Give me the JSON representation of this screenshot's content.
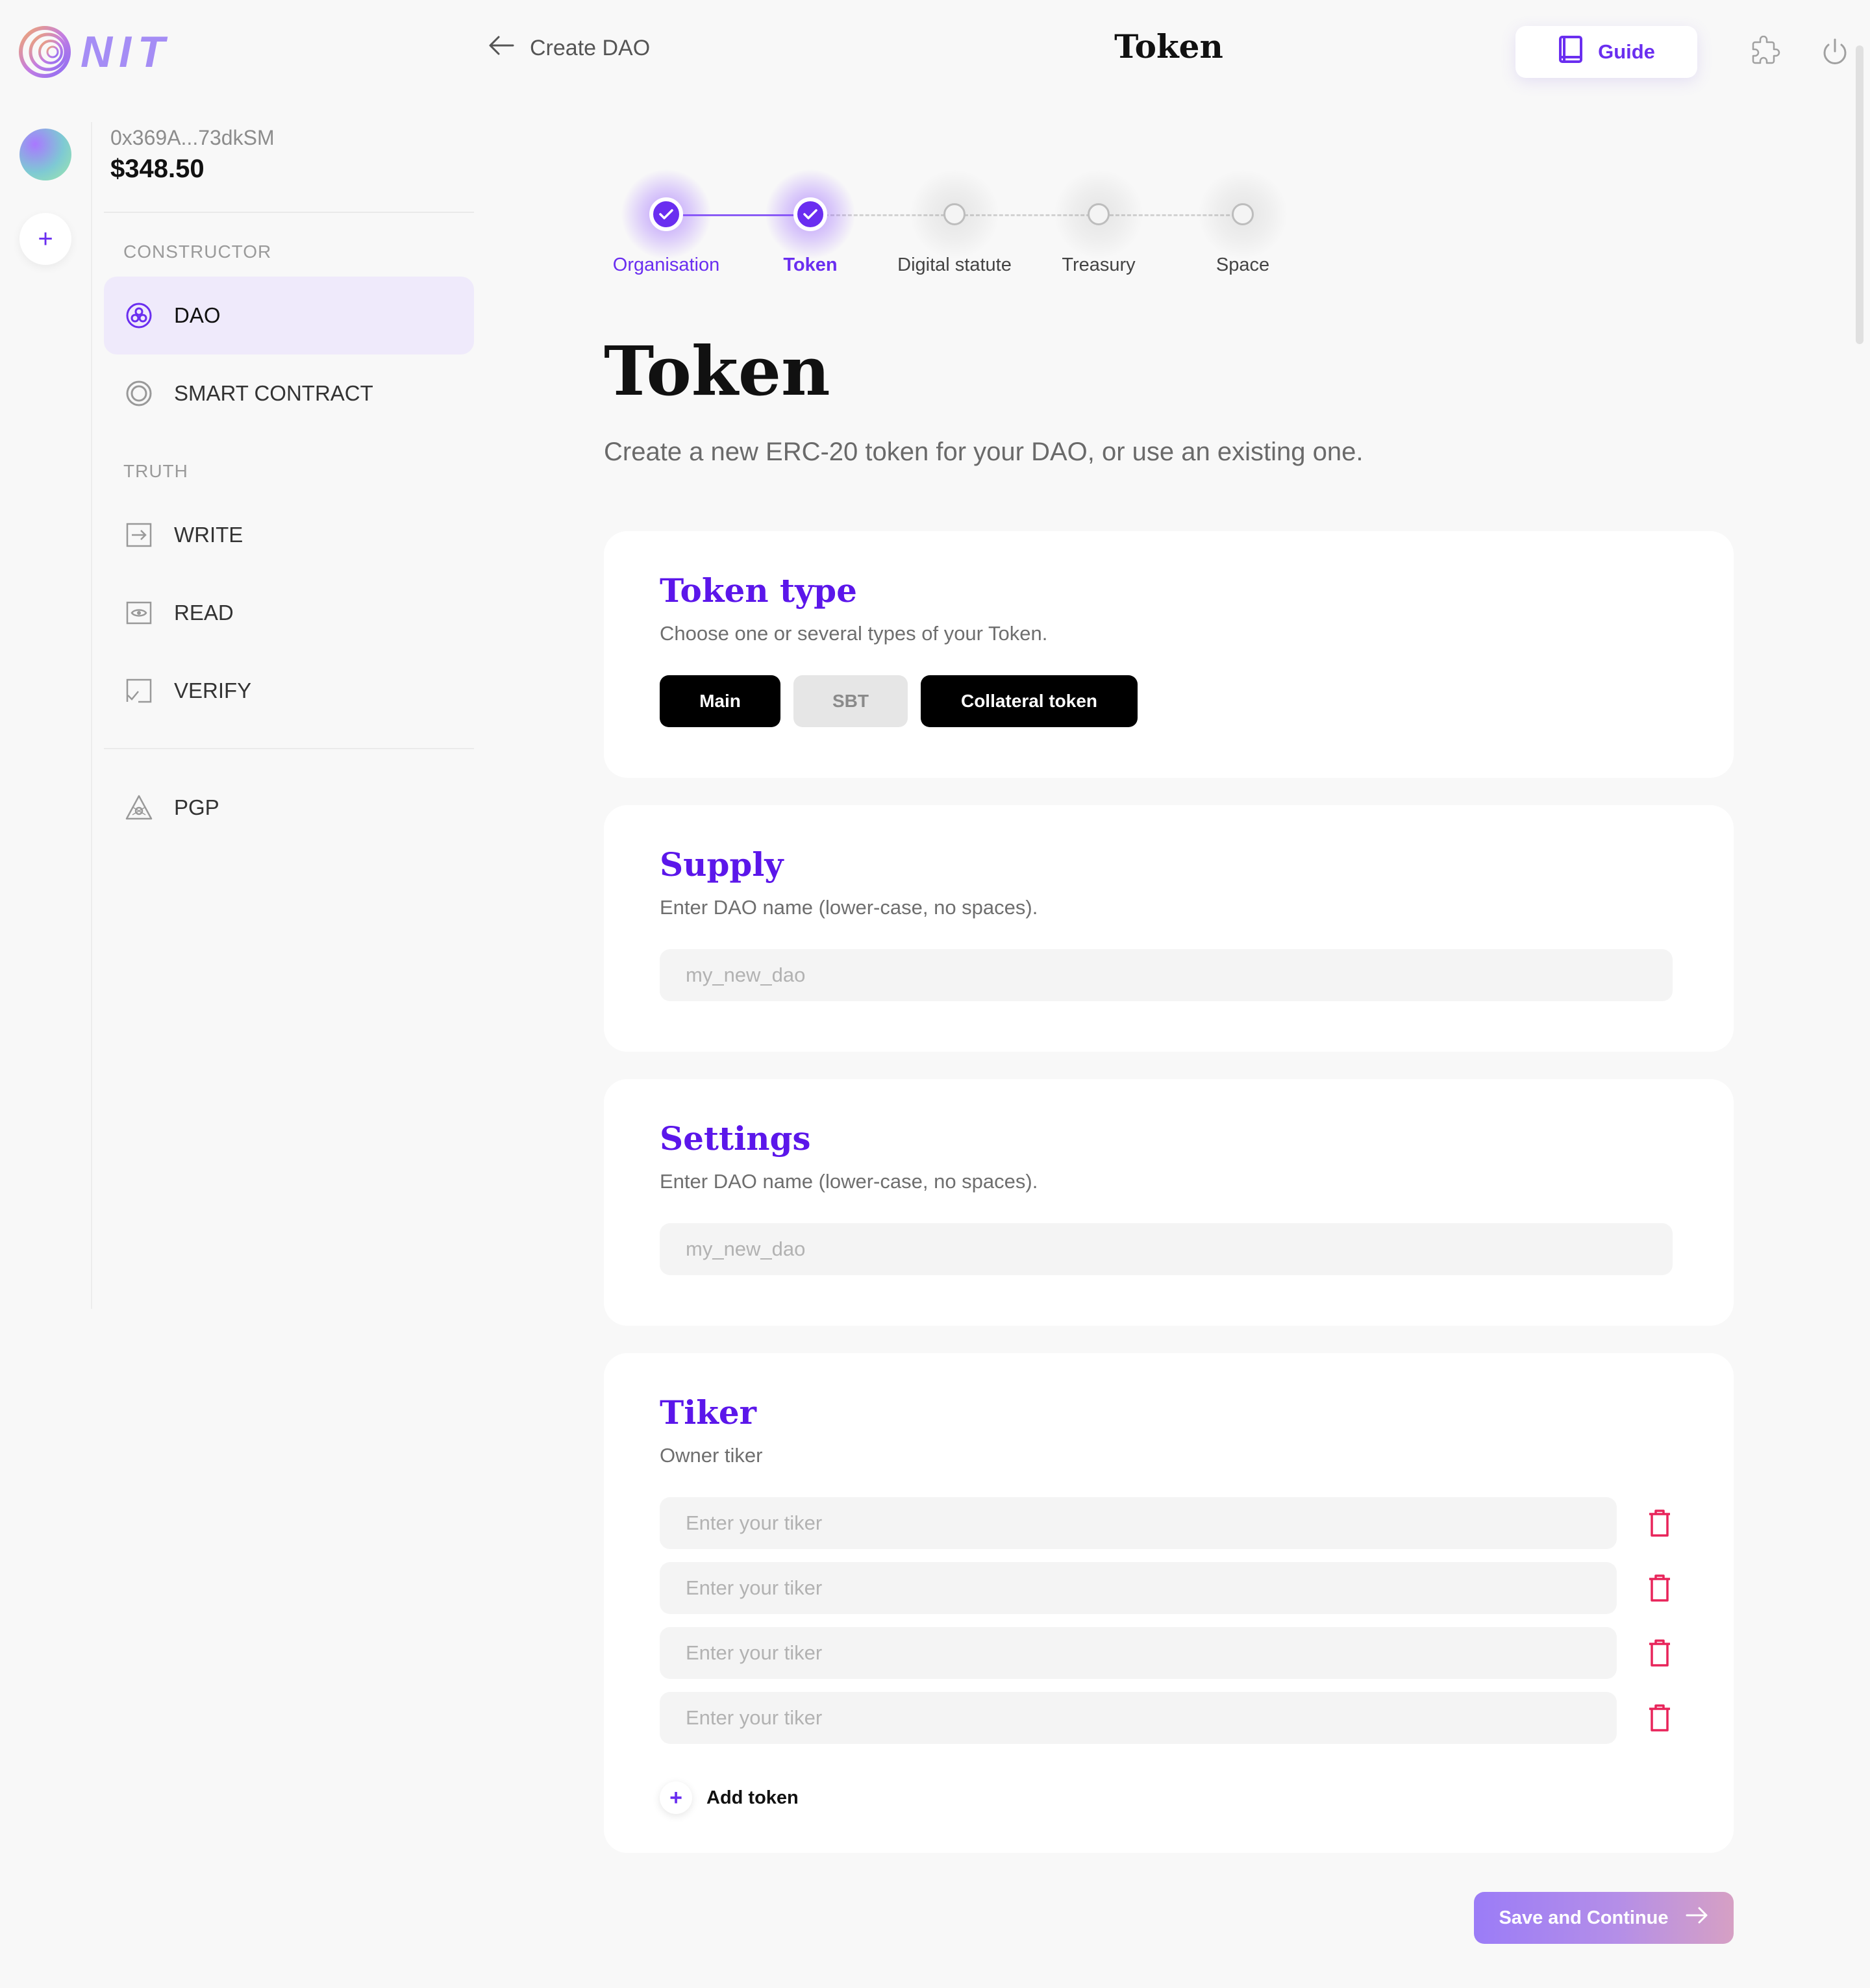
{
  "brand": {
    "name": "NIT",
    "accent": "#6a2ef0",
    "title_color": "#5b16ea"
  },
  "header": {
    "back_label": "Create DAO",
    "title": "Token",
    "guide_label": "Guide",
    "icons": [
      "arrow-left-icon",
      "book-icon",
      "puzzle-icon",
      "power-icon"
    ]
  },
  "wallet": {
    "address": "0x369A...73dkSM",
    "balance": "$348.50"
  },
  "sidebar": {
    "sections": [
      {
        "title": "CONSTRUCTOR",
        "items": [
          {
            "label": "DAO",
            "icon": "dao-icon",
            "active": true
          },
          {
            "label": "SMART CONTRACT",
            "icon": "smart-contract-icon",
            "active": false
          }
        ]
      },
      {
        "title": "TRUTH",
        "items": [
          {
            "label": "WRITE",
            "icon": "write-icon",
            "active": false
          },
          {
            "label": "READ",
            "icon": "read-icon",
            "active": false
          },
          {
            "label": "VERIFY",
            "icon": "verify-icon",
            "active": false
          }
        ]
      },
      {
        "title": "",
        "items": [
          {
            "label": "PGP",
            "icon": "pgp-icon",
            "active": false
          }
        ]
      }
    ]
  },
  "stepper": {
    "steps": [
      {
        "label": "Organisation",
        "state": "done"
      },
      {
        "label": "Token",
        "state": "current"
      },
      {
        "label": "Digital statute",
        "state": "todo"
      },
      {
        "label": "Treasury",
        "state": "todo"
      },
      {
        "label": "Space",
        "state": "todo"
      }
    ]
  },
  "page": {
    "title": "Token",
    "subtitle": "Create a new ERC-20 token for your DAO, or use an existing one."
  },
  "token_type": {
    "title": "Token type",
    "description": "Choose one or several types of your Token.",
    "options": [
      {
        "label": "Main",
        "selected": true
      },
      {
        "label": "SBT",
        "selected": false
      },
      {
        "label": "Collateral token",
        "selected": true
      }
    ]
  },
  "supply": {
    "title": "Supply",
    "description": "Enter DAO name (lower-case, no spaces).",
    "placeholder": "my_new_dao"
  },
  "settings": {
    "title": "Settings",
    "description": "Enter DAO name (lower-case, no spaces).",
    "placeholder": "my_new_dao"
  },
  "tiker": {
    "title": "Tiker",
    "description": "Owner tiker",
    "placeholder": "Enter your tiker",
    "rows": 4,
    "add_label": "Add token"
  },
  "footer": {
    "save_label": "Save and Continue"
  }
}
